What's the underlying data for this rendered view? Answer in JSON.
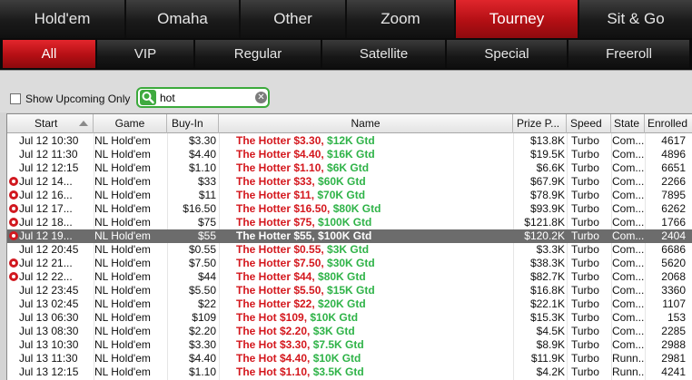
{
  "top_tabs": [
    "Hold'em",
    "Omaha",
    "Other",
    "Zoom",
    "Tourney",
    "Sit & Go"
  ],
  "sub_tabs": [
    "All",
    "VIP",
    "Regular",
    "Satellite",
    "Special",
    "Freeroll"
  ],
  "filter": {
    "show_upcoming_label": "Show Upcoming Only",
    "search_value": "hot",
    "clear_glyph": "✕"
  },
  "columns": [
    "Start",
    "Game",
    "Buy-In",
    "Name",
    "Prize P...",
    "Speed",
    "State",
    "Enrolled"
  ],
  "colors": {
    "accent_red": "#c8161c",
    "name_red": "#d4171d",
    "name_green": "#2fb348",
    "search_green": "#3caa3c",
    "selected_row": "#6c6c6c"
  },
  "rows": [
    {
      "start": "Jul 12  10:30",
      "game": "NL Hold'em",
      "buyin": "$3.30",
      "name1": "The Hotter $3.30, ",
      "name2": "$12K Gtd",
      "prize": "$13.8K",
      "speed": "Turbo",
      "state": "Com...",
      "enrolled": "4617",
      "star": false,
      "selected": false
    },
    {
      "start": "Jul 12  11:30",
      "game": "NL Hold'em",
      "buyin": "$4.40",
      "name1": "The Hotter $4.40, ",
      "name2": "$16K Gtd",
      "prize": "$19.5K",
      "speed": "Turbo",
      "state": "Com...",
      "enrolled": "4896",
      "star": false,
      "selected": false
    },
    {
      "start": "Jul 12  12:15",
      "game": "NL Hold'em",
      "buyin": "$1.10",
      "name1": "The Hotter $1.10, ",
      "name2": "$6K Gtd",
      "prize": "$6.6K",
      "speed": "Turbo",
      "state": "Com...",
      "enrolled": "6651",
      "star": false,
      "selected": false
    },
    {
      "start": "Jul 12  14...",
      "game": "NL Hold'em",
      "buyin": "$33",
      "name1": "The Hotter $33, ",
      "name2": "$60K Gtd",
      "prize": "$67.9K",
      "speed": "Turbo",
      "state": "Com...",
      "enrolled": "2266",
      "star": true,
      "selected": false
    },
    {
      "start": "Jul 12  16...",
      "game": "NL Hold'em",
      "buyin": "$11",
      "name1": "The Hotter $11, ",
      "name2": "$70K Gtd",
      "prize": "$78.9K",
      "speed": "Turbo",
      "state": "Com...",
      "enrolled": "7895",
      "star": true,
      "selected": false
    },
    {
      "start": "Jul 12  17...",
      "game": "NL Hold'em",
      "buyin": "$16.50",
      "name1": "The Hotter $16.50, ",
      "name2": "$80K Gtd",
      "prize": "$93.9K",
      "speed": "Turbo",
      "state": "Com...",
      "enrolled": "6262",
      "star": true,
      "selected": false
    },
    {
      "start": "Jul 12  18...",
      "game": "NL Hold'em",
      "buyin": "$75",
      "name1": "The Hotter $75, ",
      "name2": "$100K Gtd",
      "prize": "$121.8K",
      "speed": "Turbo",
      "state": "Com...",
      "enrolled": "1766",
      "star": true,
      "selected": false
    },
    {
      "start": "Jul 12  19...",
      "game": "NL Hold'em",
      "buyin": "$55",
      "name1": "The Hotter $55, ",
      "name2": "$100K Gtd",
      "prize": "$120.2K",
      "speed": "Turbo",
      "state": "Com...",
      "enrolled": "2404",
      "star": true,
      "selected": true
    },
    {
      "start": "Jul 12  20:45",
      "game": "NL Hold'em",
      "buyin": "$0.55",
      "name1": "The Hotter $0.55, ",
      "name2": "$3K Gtd",
      "prize": "$3.3K",
      "speed": "Turbo",
      "state": "Com...",
      "enrolled": "6686",
      "star": false,
      "selected": false
    },
    {
      "start": "Jul 12  21...",
      "game": "NL Hold'em",
      "buyin": "$7.50",
      "name1": "The Hotter $7.50, ",
      "name2": "$30K Gtd",
      "prize": "$38.3K",
      "speed": "Turbo",
      "state": "Com...",
      "enrolled": "5620",
      "star": true,
      "selected": false
    },
    {
      "start": "Jul 12  22...",
      "game": "NL Hold'em",
      "buyin": "$44",
      "name1": "The Hotter $44, ",
      "name2": "$80K Gtd",
      "prize": "$82.7K",
      "speed": "Turbo",
      "state": "Com...",
      "enrolled": "2068",
      "star": true,
      "selected": false
    },
    {
      "start": "Jul 12  23:45",
      "game": "NL Hold'em",
      "buyin": "$5.50",
      "name1": "The Hotter $5.50, ",
      "name2": "$15K Gtd",
      "prize": "$16.8K",
      "speed": "Turbo",
      "state": "Com...",
      "enrolled": "3360",
      "star": false,
      "selected": false
    },
    {
      "start": "Jul 13  02:45",
      "game": "NL Hold'em",
      "buyin": "$22",
      "name1": "The Hotter $22, ",
      "name2": "$20K Gtd",
      "prize": "$22.1K",
      "speed": "Turbo",
      "state": "Com...",
      "enrolled": "1107",
      "star": false,
      "selected": false
    },
    {
      "start": "Jul 13  06:30",
      "game": "NL Hold'em",
      "buyin": "$109",
      "name1": "The Hot $109, ",
      "name2": "$10K Gtd",
      "prize": "$15.3K",
      "speed": "Turbo",
      "state": "Com...",
      "enrolled": "153",
      "star": false,
      "selected": false
    },
    {
      "start": "Jul 13  08:30",
      "game": "NL Hold'em",
      "buyin": "$2.20",
      "name1": "The Hot $2.20, ",
      "name2": "$3K Gtd",
      "prize": "$4.5K",
      "speed": "Turbo",
      "state": "Com...",
      "enrolled": "2285",
      "star": false,
      "selected": false
    },
    {
      "start": "Jul 13  10:30",
      "game": "NL Hold'em",
      "buyin": "$3.30",
      "name1": "The Hot $3.30, ",
      "name2": "$7.5K Gtd",
      "prize": "$8.9K",
      "speed": "Turbo",
      "state": "Com...",
      "enrolled": "2988",
      "star": false,
      "selected": false
    },
    {
      "start": "Jul 13  11:30",
      "game": "NL Hold'em",
      "buyin": "$4.40",
      "name1": "The Hot $4.40, ",
      "name2": "$10K Gtd",
      "prize": "$11.9K",
      "speed": "Turbo",
      "state": "Runn...",
      "enrolled": "2981",
      "star": false,
      "selected": false
    },
    {
      "start": "Jul 13  12:15",
      "game": "NL Hold'em",
      "buyin": "$1.10",
      "name1": "The Hot $1.10, ",
      "name2": "$3.5K Gtd",
      "prize": "$4.2K",
      "speed": "Turbo",
      "state": "Runn...",
      "enrolled": "4241",
      "star": false,
      "selected": false
    }
  ]
}
